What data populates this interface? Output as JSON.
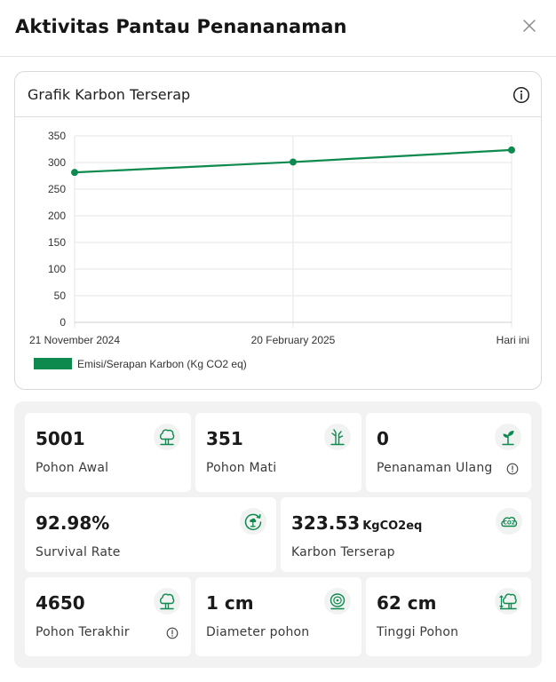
{
  "header": {
    "title": "Aktivitas Pantau Penananaman",
    "close_icon": "close-icon"
  },
  "chart_card": {
    "title": "Grafik Karbon Terserap",
    "info_icon": "info-icon"
  },
  "chart_data": {
    "type": "line",
    "title": "Grafik Karbon Terserap",
    "x": [
      "21 November 2024",
      "20 February 2025",
      "Hari ini"
    ],
    "series": [
      {
        "name": "Emisi/Serapan Karbon (Kg CO2 eq)",
        "values": [
          281.4,
          300.9,
          323.5
        ],
        "color": "#0e8a4f"
      }
    ],
    "y_ticks": [
      0,
      50,
      100,
      150,
      200,
      250,
      300,
      350
    ],
    "ylim": [
      0,
      350
    ],
    "xlabel": "",
    "ylabel": "",
    "grid": true,
    "legend": "bottom-left"
  },
  "stats": {
    "pohon_awal": {
      "value": "5001",
      "label": "Pohon Awal",
      "icon": "tree-icon"
    },
    "pohon_mati": {
      "value": "351",
      "label": "Pohon Mati",
      "icon": "dead-tree-icon"
    },
    "penanaman_ulang": {
      "value": "0",
      "label": "Penanaman Ulang",
      "icon": "sprout-icon"
    },
    "survival_rate": {
      "value": "92.98%",
      "label": "Survival Rate",
      "icon": "growth-cycle-icon"
    },
    "karbon_terserap": {
      "value": "323.53",
      "unit": "KgCO2eq",
      "label": "Karbon Terserap",
      "icon": "co2-cloud-icon"
    },
    "pohon_terakhir": {
      "value": "4650",
      "label": "Pohon Terakhir",
      "icon": "tree-icon"
    },
    "diameter_pohon": {
      "value": "1 cm",
      "label": "Diameter pohon",
      "icon": "tree-ring-icon"
    },
    "tinggi_pohon": {
      "value": "62 cm",
      "label": "Tinggi Pohon",
      "icon": "tree-height-icon"
    }
  },
  "colors": {
    "accent": "#0e8a4f",
    "icon_bg": "#f1f3f2",
    "panel_bg": "#f2f2f2"
  }
}
